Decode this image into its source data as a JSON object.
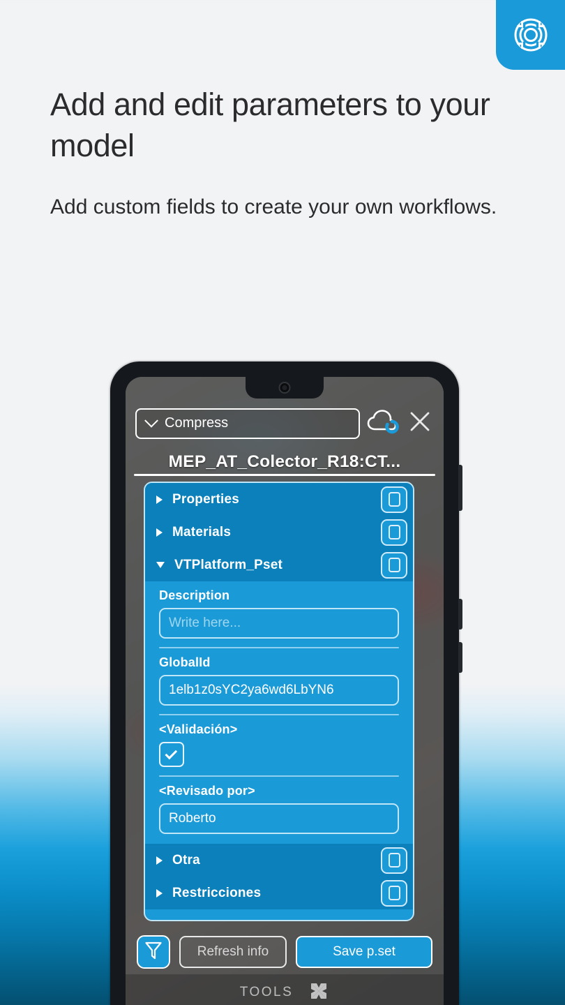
{
  "brand": {
    "logo_icon": "concentric-target-logo-icon",
    "accent_color": "#1a9ad8"
  },
  "hero": {
    "headline": "Add and edit parameters to your model",
    "subheadline": "Add custom fields to create your own workflows."
  },
  "phone_app": {
    "topbar": {
      "compress_label": "Compress",
      "chevron_icon": "chevron-down-icon",
      "cloud_sync_icon": "cloud-sync-icon",
      "close_icon": "close-icon"
    },
    "model_title": "MEP_AT_Colector_R18:CT...",
    "tree_top": [
      {
        "label": "Properties",
        "expanded": false,
        "copy_icon": "copy-icon"
      },
      {
        "label": "Materials",
        "expanded": false,
        "copy_icon": "copy-icon"
      },
      {
        "label": "VTPlatform_Pset",
        "expanded": true,
        "copy_icon": "copy-icon"
      }
    ],
    "fields": [
      {
        "label": "Description",
        "value": "",
        "placeholder": "Write here...",
        "type": "text"
      },
      {
        "label": "GlobalId",
        "value": "1elb1z0sYC2ya6wd6LbYN6",
        "placeholder": "",
        "type": "text"
      },
      {
        "label": "<Validación>",
        "value": "checked",
        "placeholder": "",
        "type": "checkbox"
      },
      {
        "label": "<Revisado por>",
        "value": "Roberto",
        "placeholder": "",
        "type": "text"
      }
    ],
    "tree_bottom": [
      {
        "label": "Otra",
        "expanded": false,
        "copy_icon": "copy-icon"
      },
      {
        "label": "Restricciones",
        "expanded": false,
        "copy_icon": "copy-icon"
      }
    ],
    "actions": {
      "filter_icon": "filter-funnel-icon",
      "refresh_label": "Refresh info",
      "save_label": "Save p.set"
    },
    "tools_bar": {
      "label": "TOOLS",
      "icon": "tools-butterfly-icon"
    }
  }
}
